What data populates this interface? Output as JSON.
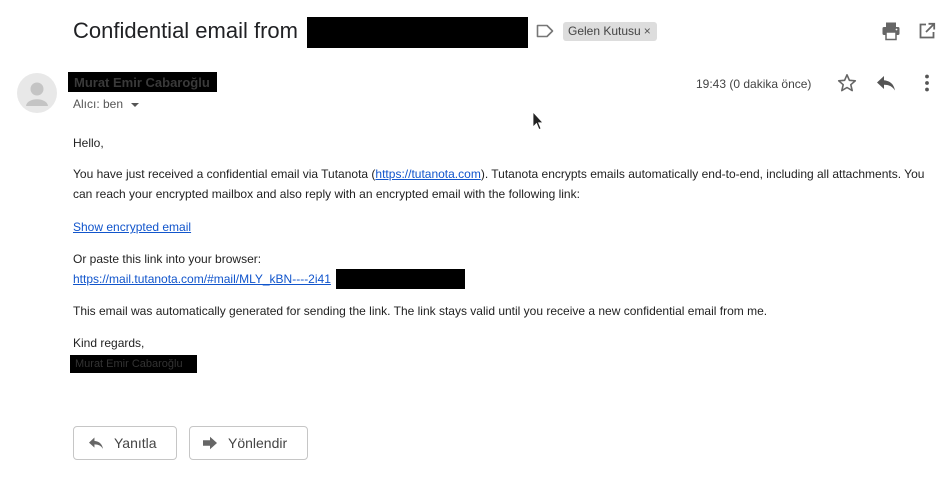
{
  "header": {
    "subject": "Confidential email from",
    "label_chip": "Gelen Kutusu",
    "label_remove": "×",
    "icons": [
      "label-arrow-icon",
      "print-icon",
      "open-in-new-window-icon"
    ]
  },
  "message": {
    "sender_name": "Murat Emir Cabaroğlu",
    "recipient": "Alıcı: ben",
    "time": "19:43 (0 dakika önce)",
    "icons": [
      "avatar-icon",
      "star-icon",
      "reply-icon",
      "more-vert-icon"
    ]
  },
  "body": {
    "greeting": "Hello,",
    "main_before_link": "You have just received a confidential email via Tutanota (",
    "main_link": "https://tutanota.com",
    "main_after_link": "). Tutanota encrypts emails automatically end-to-end, including all attachments. You can reach your encrypted mailbox and also reply with an encrypted email with the following link:",
    "show_link": "Show encrypted email",
    "paste_text": "Or paste this link into your browser:",
    "paste_link": "https://mail.tutanota.com/#mail/MLY_kBN----2i41",
    "auto_text": "This email was automatically generated for sending the link. The link stays valid until you receive a new confidential email from me.",
    "regards": "Kind regards,",
    "signature": "Murat Emir Cabaroğlu"
  },
  "actions": {
    "reply_label": "Yanıtla",
    "forward_label": "Yönlendir"
  }
}
